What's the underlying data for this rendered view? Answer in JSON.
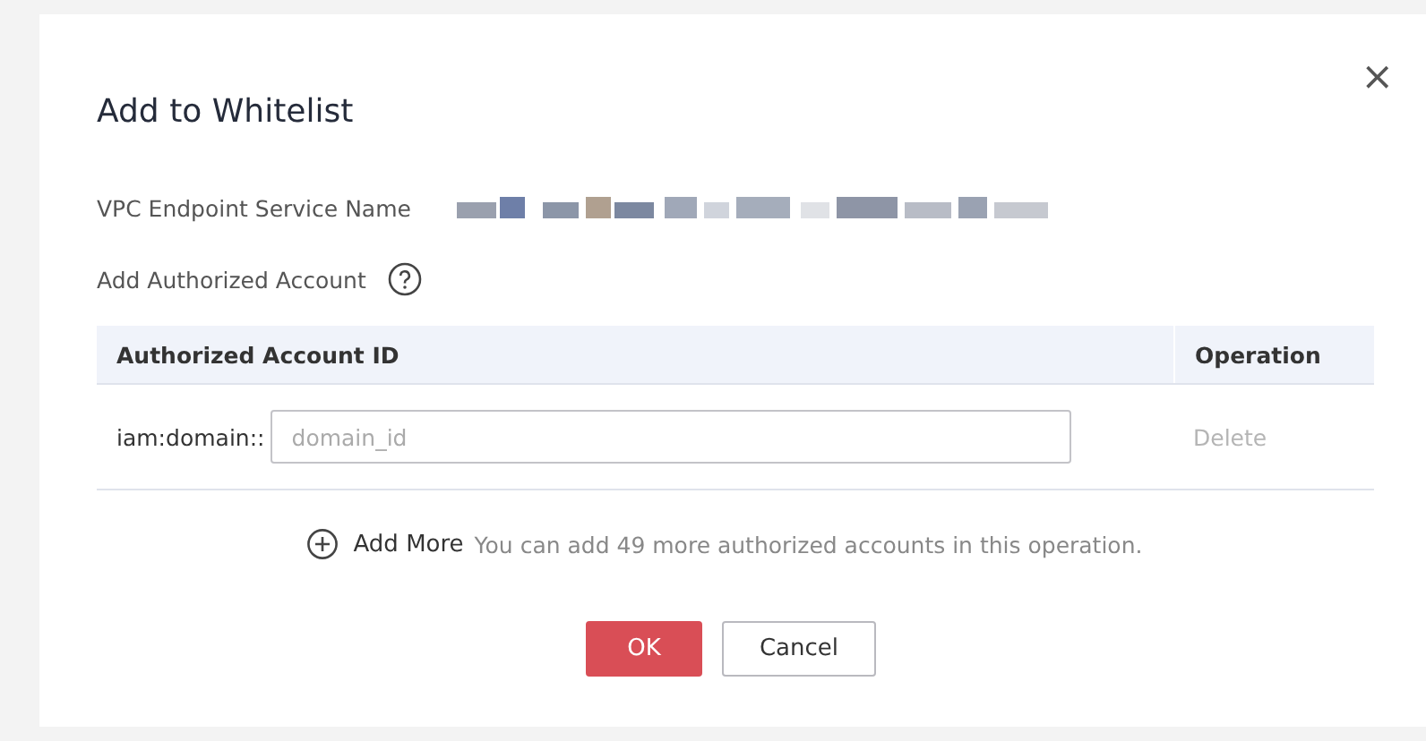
{
  "dialog": {
    "title": "Add to Whitelist",
    "close": "×"
  },
  "service": {
    "label": "VPC Endpoint Service Name"
  },
  "account": {
    "label": "Add Authorized Account"
  },
  "table": {
    "columns": [
      "Authorized Account ID",
      "Operation"
    ],
    "rows": [
      {
        "prefix": "iam:domain::",
        "placeholder": "domain_id",
        "action": "Delete",
        "disabled": true
      }
    ]
  },
  "add_more": {
    "label": "Add More",
    "hint": "You can add 49 more authorized accounts in this operation."
  },
  "buttons": [
    {
      "label": "OK",
      "kind": "primary"
    },
    {
      "label": "Cancel",
      "kind": "secondary"
    }
  ]
}
